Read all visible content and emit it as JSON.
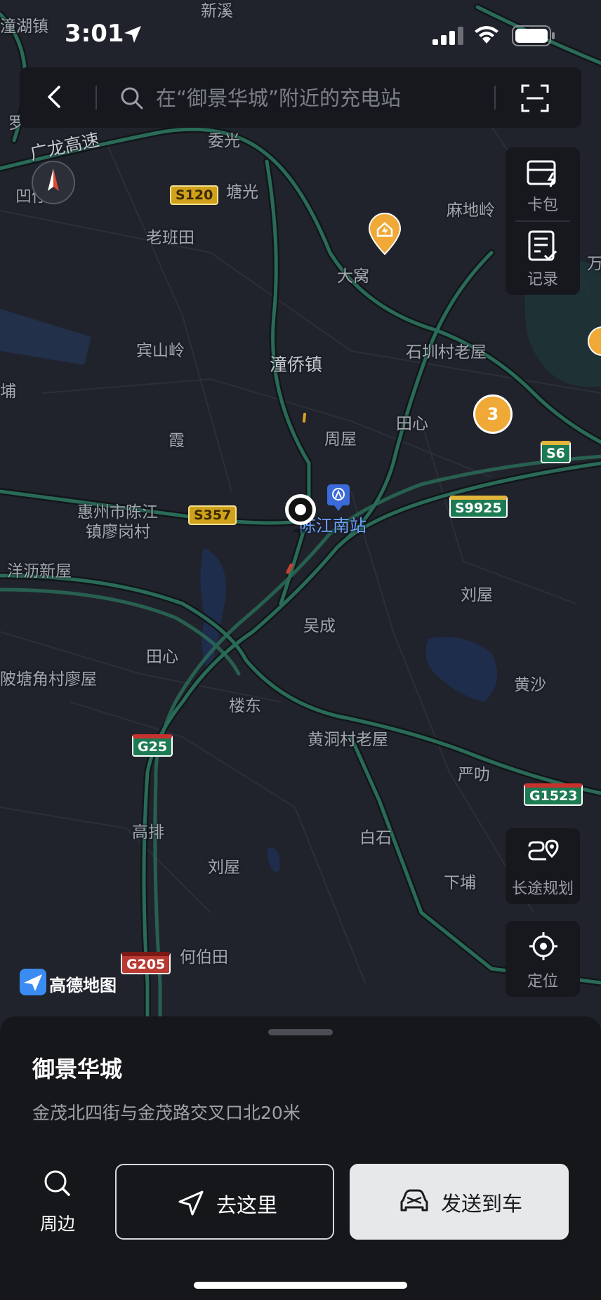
{
  "status_bar": {
    "time": "3:01"
  },
  "search": {
    "placeholder": "在“御景华城”附近的充电站"
  },
  "side_panel": {
    "card_wallet_label": "卡包",
    "records_label": "记录",
    "long_trip_label": "长途规划",
    "locate_label": "定位"
  },
  "map": {
    "places": [
      {
        "name": "潼湖镇"
      },
      {
        "name": "新溪"
      },
      {
        "name": "委光"
      },
      {
        "name": "塘光"
      },
      {
        "name": "老班田"
      },
      {
        "name": "麻地岭"
      },
      {
        "name": "大窝"
      },
      {
        "name": "宾山岭"
      },
      {
        "name": "潼侨镇"
      },
      {
        "name": "石圳村老屋"
      },
      {
        "name": "田心"
      },
      {
        "name": "霞"
      },
      {
        "name": "周屋"
      },
      {
        "name": "惠州市陈江"
      },
      {
        "name": "镇廖岗村"
      },
      {
        "name": "陈江南站"
      },
      {
        "name": "洋沥新屋"
      },
      {
        "name": "刘屋"
      },
      {
        "name": "吴成"
      },
      {
        "name": "田心"
      },
      {
        "name": "陂塘角村廖屋"
      },
      {
        "name": "楼东"
      },
      {
        "name": "黄沙"
      },
      {
        "name": "黄洞村老屋"
      },
      {
        "name": "严叻"
      },
      {
        "name": "高排"
      },
      {
        "name": "白石"
      },
      {
        "name": "刘屋"
      },
      {
        "name": "下埔"
      },
      {
        "name": "何伯田"
      },
      {
        "name": "广龙高速"
      },
      {
        "name": "凹仔"
      },
      {
        "name": "埔"
      },
      {
        "name": "罗"
      },
      {
        "name": "万"
      }
    ],
    "road_shields": [
      {
        "code": "S120"
      },
      {
        "code": "S357"
      },
      {
        "code": "S9925"
      },
      {
        "code": "S6"
      },
      {
        "code": "G25"
      },
      {
        "code": "G1523"
      },
      {
        "code": "G205"
      }
    ],
    "cluster_count": "3",
    "logo_text": "高德地图"
  },
  "sheet": {
    "title": "御景华城",
    "address": "金茂北四街与金茂路交叉口北20米",
    "nearby_label": "周边",
    "go_label": "去这里",
    "send_label": "发送到车"
  }
}
